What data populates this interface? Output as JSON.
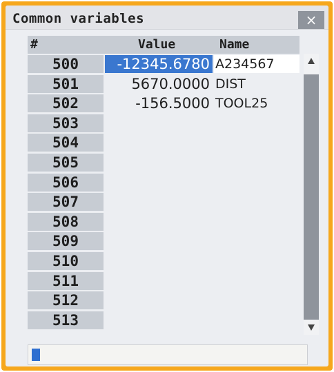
{
  "window": {
    "title": "Common variables"
  },
  "close_icon": "×",
  "table": {
    "headers": {
      "num": "#",
      "value": "Value",
      "name": "Name"
    },
    "rows": [
      {
        "num": "500",
        "value": "-12345.6780",
        "name": "A234567"
      },
      {
        "num": "501",
        "value": "5670.0000",
        "name": "DIST"
      },
      {
        "num": "502",
        "value": "-156.5000",
        "name": "TOOL25"
      },
      {
        "num": "503",
        "value": "",
        "name": ""
      },
      {
        "num": "504",
        "value": "",
        "name": ""
      },
      {
        "num": "505",
        "value": "",
        "name": ""
      },
      {
        "num": "506",
        "value": "",
        "name": ""
      },
      {
        "num": "507",
        "value": "",
        "name": ""
      },
      {
        "num": "508",
        "value": "",
        "name": ""
      },
      {
        "num": "509",
        "value": "",
        "name": ""
      },
      {
        "num": "510",
        "value": "",
        "name": ""
      },
      {
        "num": "511",
        "value": "",
        "name": ""
      },
      {
        "num": "512",
        "value": "",
        "name": ""
      },
      {
        "num": "513",
        "value": "",
        "name": ""
      }
    ],
    "selected_row": 0
  },
  "scrollbar": {
    "up_icon": "triangle-up-icon",
    "down_icon": "triangle-down-icon"
  },
  "input": {
    "value": ""
  },
  "colors": {
    "frame": "#f6a71c",
    "selection": "#3a77cf",
    "row_header": "#c7ccd3"
  }
}
